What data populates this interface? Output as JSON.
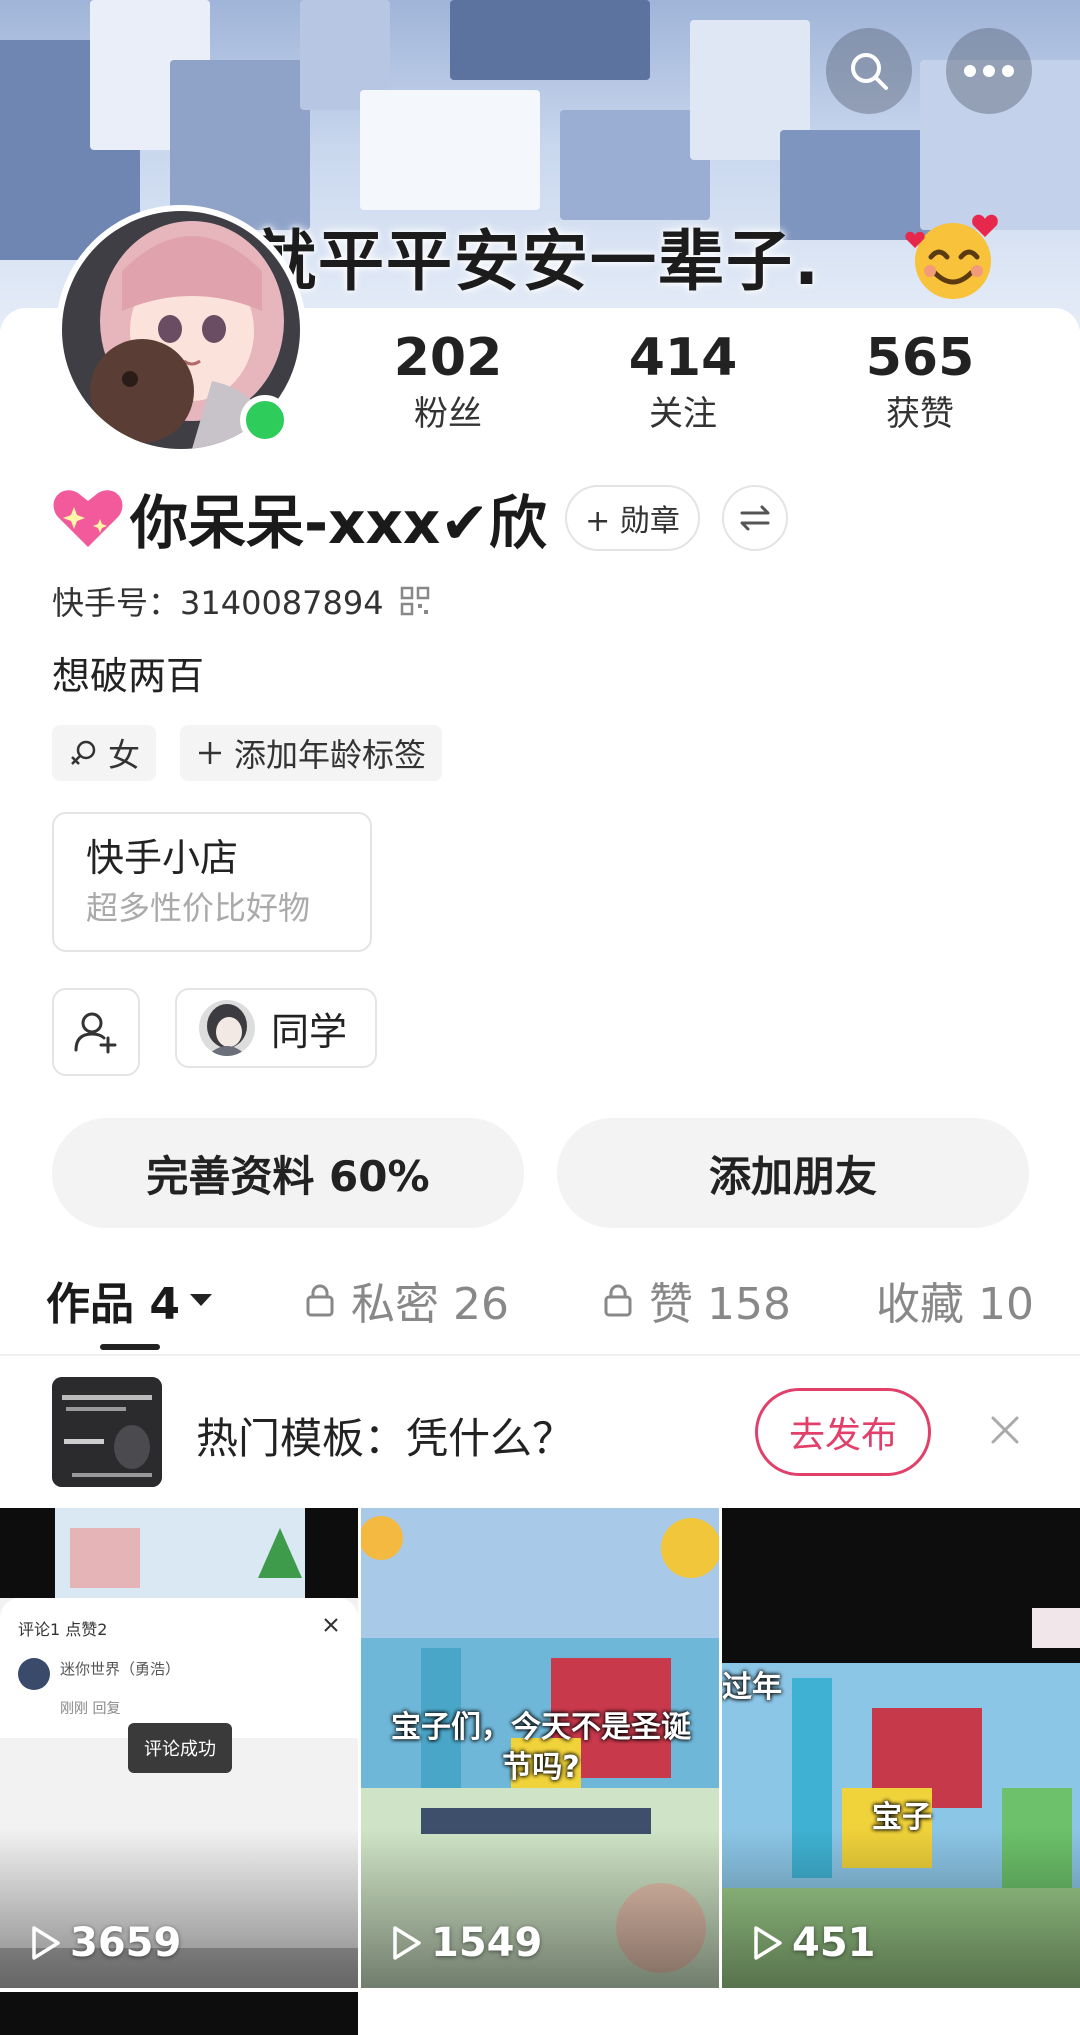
{
  "banner": {
    "caption": "就平平安安一辈子.",
    "emoji_icon": "smiling-face-with-hearts-icon",
    "search_icon": "search-icon",
    "more_icon": "more-dots-icon"
  },
  "profile": {
    "stats": [
      {
        "value": "202",
        "label": "粉丝"
      },
      {
        "value": "414",
        "label": "关注"
      },
      {
        "value": "565",
        "label": "获赞"
      }
    ],
    "online": true,
    "name": "你呆呆-xxx✔欣",
    "name_prefix_icon": "sparkling-heart-icon",
    "medal_label": "+ 勋章",
    "kuaishou_id_label": "快手号：3140087894",
    "bio": "想破两百",
    "tags": [
      {
        "icon": "female-icon",
        "label": "女"
      },
      {
        "icon": "plus-icon",
        "label": "添加年龄标签"
      }
    ],
    "shop": {
      "title": "快手小店",
      "subtitle": "超多性价比好物"
    },
    "classmate_label": "同学",
    "complete_profile_label": "完善资料 60%",
    "add_friend_label": "添加朋友"
  },
  "tabs": [
    {
      "label": "作品 4",
      "active": true,
      "locked": false,
      "has_dropdown": true
    },
    {
      "label": "私密 26",
      "active": false,
      "locked": true
    },
    {
      "label": "赞 158",
      "active": false,
      "locked": true
    },
    {
      "label": "收藏 10",
      "active": false,
      "locked": false
    }
  ],
  "template_banner": {
    "text": "热门模板：凭什么？",
    "publish_label": "去发布"
  },
  "videos": [
    {
      "plays": "3659",
      "overlay_tabs": "评论1   点赞2",
      "overlay_user": "迷你世界（勇浩）",
      "overlay_meta": "刚刚  回复",
      "overlay_toast": "评论成功"
    },
    {
      "plays": "1549",
      "subtitle": "宝子们，今天不是圣诞节吗?"
    },
    {
      "plays": "451",
      "subtitle": "宝子",
      "side_text": "过年"
    }
  ],
  "colors": {
    "accent": "#e0406a",
    "online": "#2ecc5a",
    "button_bg": "#f3f3f3"
  }
}
